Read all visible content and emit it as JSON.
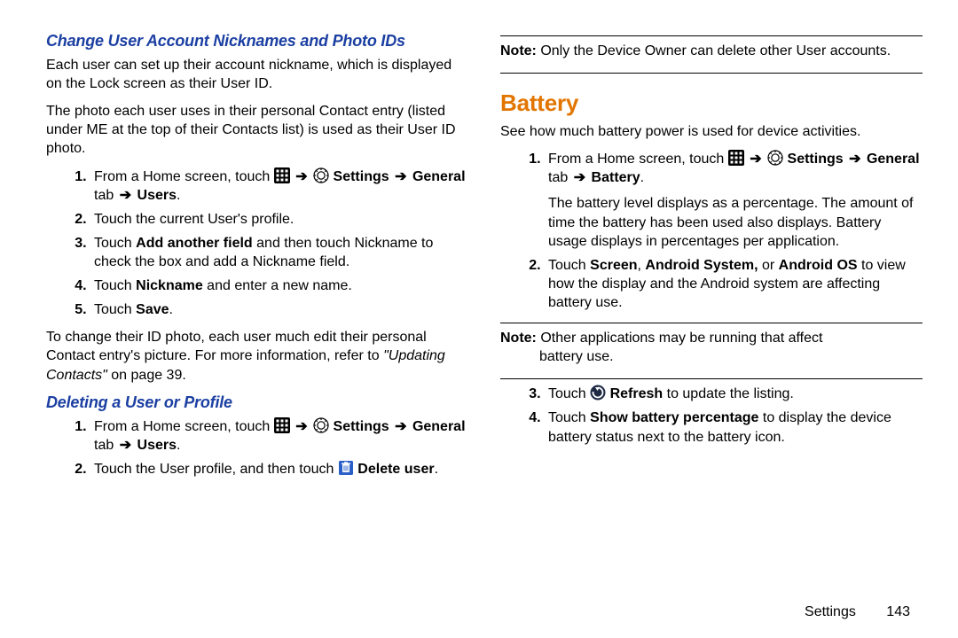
{
  "left": {
    "h1": "Change User Account Nicknames and Photo IDs",
    "p1": "Each user can set up their account nickname, which is displayed on the Lock screen as their User ID.",
    "p2": "The photo each user uses in their personal Contact entry (listed under ME at the top of their Contacts list) is used as their User ID photo.",
    "ol1": {
      "i1a": "From a Home screen, touch ",
      "settings": " Settings ",
      "arrow": "➔",
      "i1b_general": "General",
      "i1b_tab": " tab ",
      "i1b_users": " Users",
      "i1b_period": ".",
      "i2": "Touch the current User's profile.",
      "i3a": "Touch ",
      "i3b": "Add another field",
      "i3c": " and then touch Nickname to check the box and add a Nickname field.",
      "i4a": "Touch ",
      "i4b": "Nickname",
      "i4c": " and enter a new name.",
      "i5a": "Touch ",
      "i5b": "Save",
      "i5c": "."
    },
    "p3a": "To change their ID photo, each user much edit their personal Contact entry's picture. For more information, refer to ",
    "p3b": "\"Updating Contacts\"",
    "p3c": " on page 39.",
    "h2": "Deleting a User or Profile",
    "ol2": {
      "i1a": "From a Home screen, touch ",
      "settings": " Settings ",
      "arrow": "➔",
      "i1b_general": "General",
      "i1b_tab": " tab ",
      "i1b_users": " Users",
      "i1b_period": ".",
      "i2a": "Touch the User profile, and then touch ",
      "i2b": " Delete user",
      "i2c": "."
    }
  },
  "right": {
    "note1a": "Note:",
    "note1b": " Only the Device Owner can delete other User accounts.",
    "h1": "Battery",
    "p1": "See how much battery power is used for device activities.",
    "ol1": {
      "i1a": "From a Home screen, touch ",
      "settings": " Settings ",
      "arrow": "➔",
      "i1b_general": "General",
      "i1b_tab": " tab ",
      "i1b_battery": " Battery",
      "i1b_period": ".",
      "i1c": "The battery level displays as a percentage. The amount of time the battery has been used also displays. Battery usage displays in percentages per application.",
      "i2a": "Touch ",
      "i2b": "Screen",
      "i2c": ", ",
      "i2d": "Android System,",
      "i2e": " or ",
      "i2f": "Android OS",
      "i2g": " to view how the display and the Android system are affecting battery use."
    },
    "note2a": "Note:",
    "note2b": " Other applications may be running that affect",
    "note2c": "battery use.",
    "ol2": {
      "i3a": "Touch ",
      "i3b": " Refresh",
      "i3c": " to update the listing.",
      "i4a": "Touch ",
      "i4b": "Show battery percentage",
      "i4c": " to display the device battery status next to the battery icon."
    }
  },
  "footer": {
    "section": "Settings",
    "page": "143"
  }
}
